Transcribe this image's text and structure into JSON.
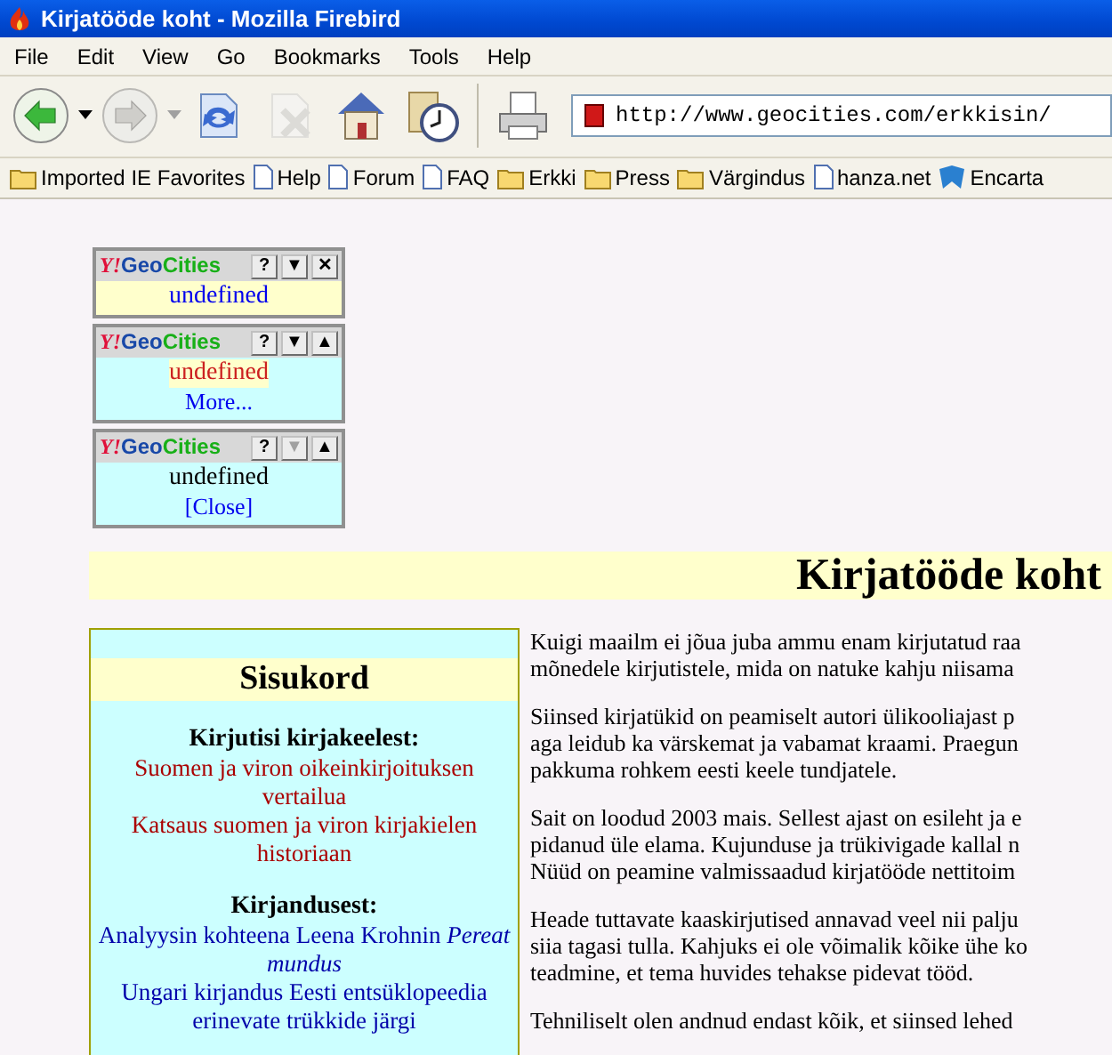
{
  "window": {
    "title": "Kirjatööde koht - Mozilla Firebird"
  },
  "menu": [
    "File",
    "Edit",
    "View",
    "Go",
    "Bookmarks",
    "Tools",
    "Help"
  ],
  "toolbar": [
    {
      "kind": "back",
      "disabled": false
    },
    {
      "kind": "forward",
      "disabled": true
    },
    {
      "kind": "reload",
      "disabled": false
    },
    {
      "kind": "stop",
      "disabled": true
    },
    {
      "kind": "home",
      "disabled": false
    },
    {
      "kind": "history",
      "disabled": false
    },
    {
      "kind": "print",
      "disabled": false
    }
  ],
  "address": {
    "value": "http://www.geocities.com/erkkisin/"
  },
  "bookmarks": [
    {
      "kind": "folder",
      "label": "Imported IE Favorites"
    },
    {
      "kind": "page",
      "label": "Help"
    },
    {
      "kind": "page",
      "label": "Forum"
    },
    {
      "kind": "page",
      "label": "FAQ"
    },
    {
      "kind": "folder",
      "label": "Erkki"
    },
    {
      "kind": "folder",
      "label": "Press"
    },
    {
      "kind": "folder",
      "label": "Värgindus"
    },
    {
      "kind": "page",
      "label": "hanza.net"
    },
    {
      "kind": "site",
      "label": "Encarta"
    }
  ],
  "widgets": [
    {
      "brand": {
        "y": "Y!",
        "geo": "Geo",
        "cities": "Cities"
      },
      "buttons": [
        {
          "label": "?",
          "disabled": false
        },
        {
          "label": "▼",
          "disabled": false
        },
        {
          "label": "✕",
          "disabled": false
        }
      ],
      "text": {
        "label": "undefined",
        "kind": "link"
      }
    },
    {
      "brand": {
        "y": "Y!",
        "geo": "Geo",
        "cities": "Cities"
      },
      "buttons": [
        {
          "label": "?",
          "disabled": false
        },
        {
          "label": "▼",
          "disabled": false
        },
        {
          "label": "▲",
          "disabled": false
        }
      ],
      "text": {
        "label": "undefined",
        "kind": "hover"
      },
      "link": "More..."
    },
    {
      "brand": {
        "y": "Y!",
        "geo": "Geo",
        "cities": "Cities"
      },
      "buttons": [
        {
          "label": "?",
          "disabled": false
        },
        {
          "label": "▼",
          "disabled": true
        },
        {
          "label": "▲",
          "disabled": false
        }
      ],
      "text": {
        "label": "undefined",
        "kind": "plain"
      },
      "link": "[Close]"
    }
  ],
  "page_title": "Kirjatööde koht",
  "contents": {
    "heading": "Sisukord",
    "sections": [
      {
        "title": "Kirjutisi kirjakeelest:",
        "color": "#aa0000",
        "items": [
          {
            "text": "Suomen ja viron oikeinkirjoituksen vertailua"
          },
          {
            "text": "Katsaus suomen ja viron kirjakielen historiaan"
          }
        ]
      },
      {
        "title": "Kirjandusest:",
        "color": "#0000aa",
        "items": [
          {
            "text": "Analyysin kohteena Leena Krohnin *Pereat mundus*"
          },
          {
            "text": "Ungari kirjandus Eesti entsüklopeedia erinevate trükkide järgi"
          }
        ]
      }
    ]
  },
  "paragraphs": [
    [
      "Kuigi maailm ei jõua juba ammu enam kirjutatud raa",
      "mõnedele kirjutistele, mida on natuke kahju niisama"
    ],
    [
      "Siinsed kirjatükid on peamiselt autori ülikooliajast p",
      "aga leidub ka värskemat ja vabamat kraami. Praegun",
      "pakkuma rohkem eesti keele tundjatele."
    ],
    [
      "Sait on loodud 2003 mais. Sellest ajast on esileht ja e",
      "pidanud üle elama. Kujunduse ja trükivigade kallal n",
      "Nüüd on peamine valmissaadud kirjatööde nettitoim"
    ],
    [
      "Heade tuttavate kaaskirjutised annavad veel nii palju",
      "siia tagasi tulla. Kahjuks ei ole võimalik kõike ühe ko",
      "teadmine, et tema huvides tehakse pidevat tööd."
    ],
    [
      "Tehniliselt olen andnud endast kõik, et siinsed lehed"
    ]
  ]
}
